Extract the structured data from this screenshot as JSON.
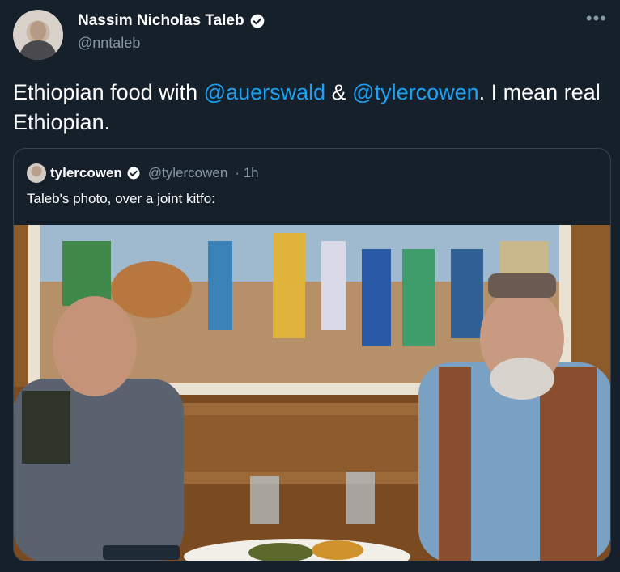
{
  "author": {
    "display_name": "Nassim Nicholas Taleb",
    "handle": "@nntaleb"
  },
  "tweet": {
    "prefix": "Ethiopian food with ",
    "mention1": "@auerswald",
    "middle": " & ",
    "mention2": "@tylercowen",
    "suffix": ". I mean real Ethiopian."
  },
  "quote": {
    "display_name": "tylercowen",
    "handle": "@tylercowen",
    "time": "· 1h",
    "text": "Taleb's photo, over a joint kitfo:"
  },
  "icons": {
    "verified": "verified-badge-icon",
    "more": "more-dots-icon"
  },
  "colors": {
    "background": "#15202b",
    "link": "#1da1f2",
    "secondary_text": "#8899a6",
    "border": "#38444d"
  }
}
